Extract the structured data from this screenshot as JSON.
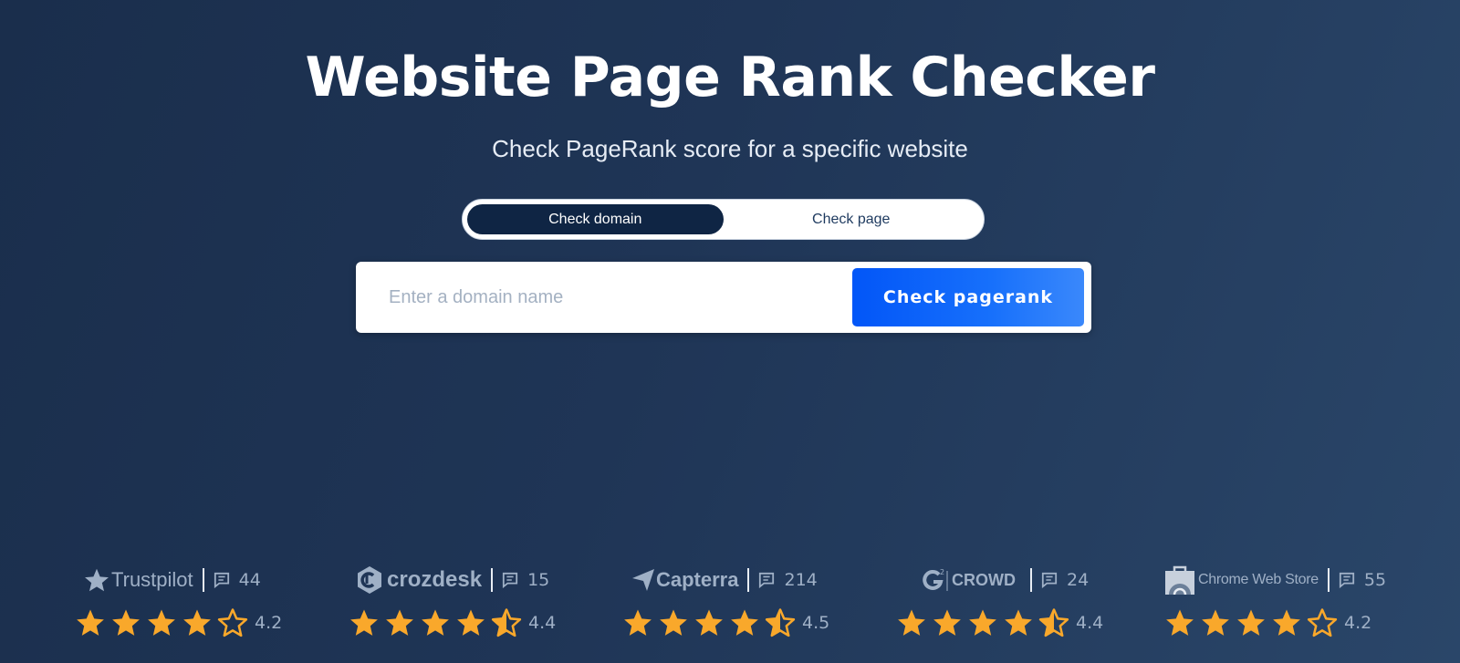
{
  "header": {
    "title": "Website Page Rank Checker",
    "subtitle": "Check PageRank score for a specific website"
  },
  "toggle": {
    "options": [
      {
        "label": "Check domain",
        "active": true
      },
      {
        "label": "Check page",
        "active": false
      }
    ]
  },
  "search": {
    "placeholder": "Enter a domain name",
    "value": "",
    "button_label": "Check pagerank"
  },
  "colors": {
    "background_start": "#1a2e4c",
    "background_end": "#2a4669",
    "toggle_active": "#0f2544",
    "button_blue": "#0256f8",
    "star": "#f9a82b",
    "muted_text": "#9fb0c6"
  },
  "reviews": [
    {
      "platform": "Trustpilot",
      "logo_icon": "trustpilot-star-icon",
      "review_count": "44",
      "rating": "4.2",
      "stars": 4.2
    },
    {
      "platform": "crozdesk",
      "logo_icon": "crozdesk-icon",
      "review_count": "15",
      "rating": "4.4",
      "stars": 4.4
    },
    {
      "platform": "Capterra",
      "logo_icon": "capterra-arrow-icon",
      "review_count": "214",
      "rating": "4.5",
      "stars": 4.5
    },
    {
      "platform": "CROWD",
      "logo_icon": "g2-icon",
      "review_count": "24",
      "rating": "4.4",
      "stars": 4.4
    },
    {
      "platform": "Chrome Web Store",
      "logo_icon": "chrome-web-store-icon",
      "review_count": "55",
      "rating": "4.2",
      "stars": 4.2
    }
  ]
}
